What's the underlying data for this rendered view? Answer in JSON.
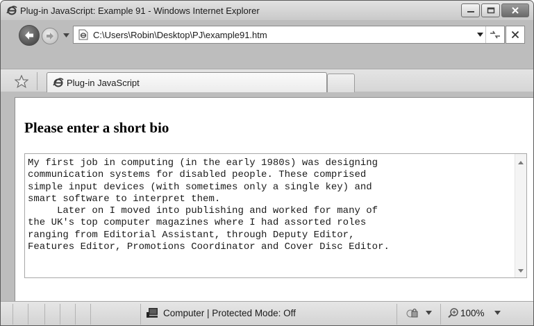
{
  "window": {
    "title": "Plug-in JavaScript: Example 91 - Windows Internet Explorer"
  },
  "navigation": {
    "address": "C:\\Users\\Robin\\Desktop\\PJ\\example91.htm"
  },
  "tabs": {
    "active_label": "Plug-in JavaScript"
  },
  "page": {
    "heading": "Please enter a short bio",
    "bio_text": "My first job in computing (in the early 1980s) was designing\ncommunication systems for disabled people. These comprised\nsimple input devices (with sometimes only a single key) and\nsmart software to interpret them.\n     Later on I moved into publishing and worked for many of\nthe UK's top computer magazines where I had assorted roles\nranging from Editorial Assistant, through Deputy Editor,\nFeatures Editor, Promotions Coordinator and Cover Disc Editor."
  },
  "status": {
    "zone": "Computer | Protected Mode: Off",
    "zoom": "100%"
  },
  "icons": {
    "ie": "ie-logo-icon",
    "back": "back-arrow-icon",
    "forward": "forward-arrow-icon",
    "favorites": "star-icon",
    "zone": "computer-zone-icon",
    "security": "security-icon",
    "zoom": "magnifier-icon"
  }
}
